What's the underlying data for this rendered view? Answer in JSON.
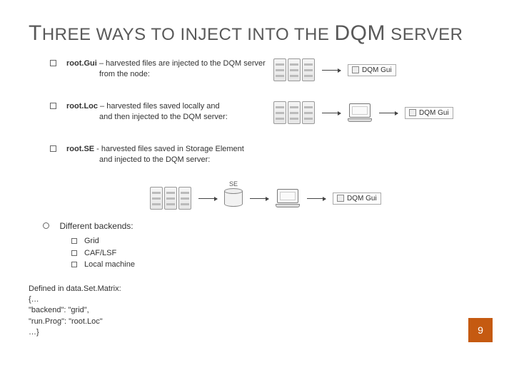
{
  "title": {
    "t1_cap": "T",
    "t1_rest": "HREE WAYS TO INJECT INTO THE",
    "t2_cap": "DQM",
    "t2_rest": " SERVER"
  },
  "methods": [
    {
      "name": "root.Gui",
      "desc_line1": " – harvested files are injected to the DQM server",
      "desc_line2": "from the node:"
    },
    {
      "name": "root.Loc",
      "desc_line1": " – harvested files saved locally and",
      "desc_line2": "and then injected to the DQM server:"
    },
    {
      "name": "root.SE",
      "desc_line1": " - harvested files saved in Storage Element",
      "desc_line2": "and injected to the DQM server:"
    }
  ],
  "dqm_label": "DQM Gui",
  "se_label": "SE",
  "backends": {
    "heading": "Different backends:",
    "items": [
      "Grid",
      "CAF/LSF",
      "Local machine"
    ]
  },
  "code": {
    "l1": "Defined in data.Set.Matrix:",
    "l2": "{…",
    "l3": "\"backend\": \"grid\",",
    "l4": "\"run.Prog\": \"root.Loc\"",
    "l5": "…}"
  },
  "page_number": "9"
}
